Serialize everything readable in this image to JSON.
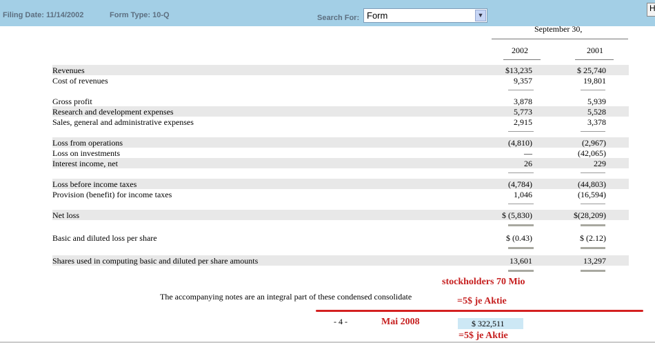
{
  "toolbar": {
    "filing_date": "Filing Date: 11/14/2002",
    "form_type": "Form Type: 10-Q",
    "search_label": "Search For:",
    "search_value": "Form",
    "corner_label": "H"
  },
  "table": {
    "period": "September 30,",
    "col1": "2002",
    "col2": "2001",
    "rows": [
      {
        "label": "Revenues",
        "v1": "$13,235",
        "v2": "$ 25,740"
      },
      {
        "label": "Cost of revenues",
        "v1": "9,357",
        "v2": "19,801"
      },
      {
        "label": "Gross profit",
        "v1": "3,878",
        "v2": "5,939"
      },
      {
        "label": "Research and development expenses",
        "v1": "5,773",
        "v2": "5,528"
      },
      {
        "label": "Sales, general and administrative expenses",
        "v1": "2,915",
        "v2": "3,378"
      },
      {
        "label": "Loss from operations",
        "v1": "(4,810)",
        "v2": "(2,967)"
      },
      {
        "label": "Loss on investments",
        "v1": "—",
        "v2": "(42,065)"
      },
      {
        "label": "Interest income, net",
        "v1": "26",
        "v2": "229"
      },
      {
        "label": "Loss before income taxes",
        "v1": "(4,784)",
        "v2": "(44,803)"
      },
      {
        "label": "Provision (benefit) for income taxes",
        "v1": "1,046",
        "v2": "(16,594)"
      },
      {
        "label": "Net loss",
        "v1": "$ (5,830)",
        "v2": "$(28,209)"
      },
      {
        "label": "Basic and diluted loss per share",
        "v1": "$ (0.43)",
        "v2": "$ (2.12)"
      },
      {
        "label": "Shares used in computing basic and diluted per share amounts",
        "v1": "13,601",
        "v2": "13,297"
      }
    ]
  },
  "footer": {
    "note": "The accompanying notes are an integral part of these condensed consolidate",
    "page_number": "- 4 -",
    "price": "$ 322,511"
  },
  "annotations": {
    "stockholders": "stockholders 70 Mio",
    "per_share_1": "=5$ je Aktie",
    "date": "Mai 2008",
    "per_share_2": "=5$ je Aktie"
  }
}
